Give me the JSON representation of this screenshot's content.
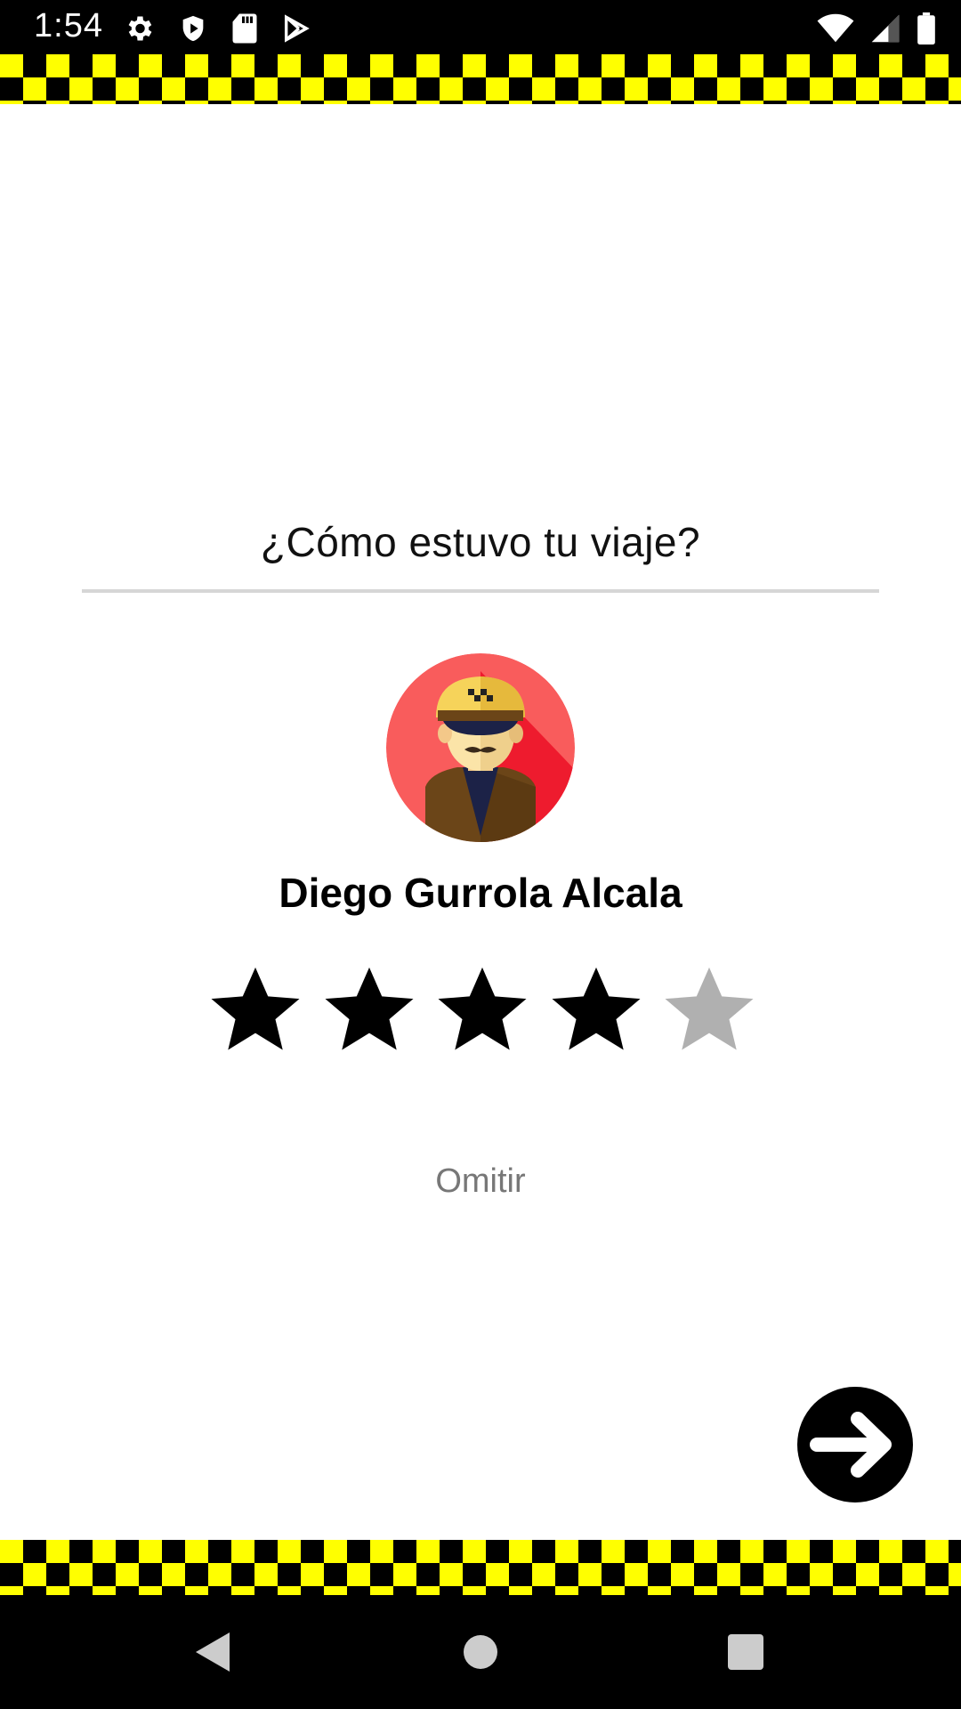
{
  "status_bar": {
    "time": "1:54",
    "left_icons": [
      "gear-icon",
      "shield-play-icon",
      "sd-card-icon",
      "play-store-icon"
    ],
    "right_icons": [
      "wifi-icon",
      "signal-icon",
      "battery-icon"
    ]
  },
  "rating": {
    "question": "¿Cómo estuvo tu viaje?",
    "driver_name": "Diego Gurrola Alcala",
    "stars_total": 5,
    "stars_selected": 4,
    "skip_label": "Omitir"
  },
  "colors": {
    "checker_yellow": "#ffff00",
    "checker_black": "#000000",
    "star_filled": "#000000",
    "star_empty": "#b0b0b0",
    "avatar_bg": "#f95c5c"
  },
  "nav_bar": {
    "icons": [
      "back-icon",
      "home-icon",
      "recents-icon"
    ]
  }
}
